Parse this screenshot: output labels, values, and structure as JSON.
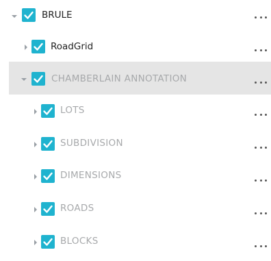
{
  "layers": [
    {
      "label": "BRULE",
      "expanded": true,
      "checked": true
    },
    {
      "label": "RoadGrid",
      "expanded": false,
      "checked": true
    },
    {
      "label": "CHAMBERLAIN ANNOTATION",
      "expanded": true,
      "checked": true,
      "selected": true
    },
    {
      "label": "LOTS",
      "expanded": false,
      "checked": true
    },
    {
      "label": "SUBDIVISION",
      "expanded": false,
      "checked": true
    },
    {
      "label": "DIMENSIONS",
      "expanded": false,
      "checked": true
    },
    {
      "label": "ROADS",
      "expanded": false,
      "checked": true
    },
    {
      "label": "BLOCKS",
      "expanded": false,
      "checked": true
    }
  ],
  "more_icon": "more-horizontal-icon",
  "colors": {
    "checkbox": "#1fb3cf",
    "selected_row": "#e5e5e5",
    "muted_text": "#a7a9ab",
    "dark_text": "#222222"
  }
}
